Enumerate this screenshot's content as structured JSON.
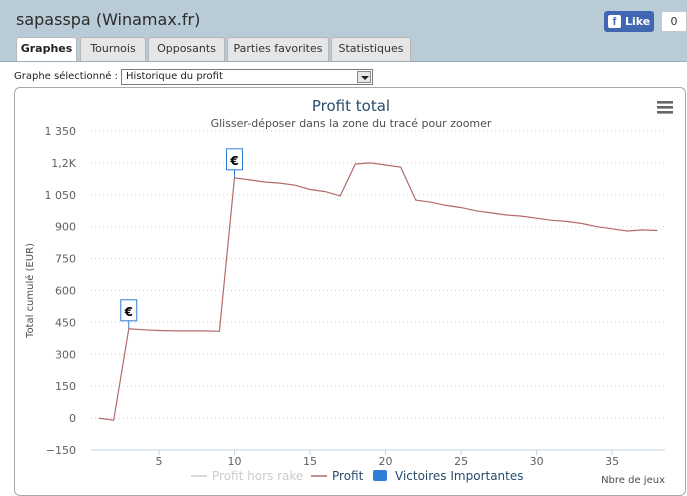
{
  "header": {
    "title": "sapasspa (Winamax.fr)",
    "like": {
      "label": "Like",
      "count": "0",
      "icon": "facebook-icon"
    }
  },
  "tabs": [
    {
      "label": "Graphes",
      "active": true
    },
    {
      "label": "Tournois",
      "active": false
    },
    {
      "label": "Opposants",
      "active": false
    },
    {
      "label": "Parties favorites",
      "active": false
    },
    {
      "label": "Statistiques",
      "active": false
    }
  ],
  "graph_select": {
    "label": "Graphe sélectionné :",
    "value": "Historique du profit"
  },
  "chart_menu_icon": "hamburger-menu-icon",
  "chart_data": {
    "type": "line",
    "title": "Profit total",
    "subtitle": "Glisser-déposer dans la zone du tracé pour zoomer",
    "xlabel": "Nbre de jeux",
    "ylabel": "Total cumulé (EUR)",
    "xlim": [
      0.5,
      38.5
    ],
    "ylim": [
      -150,
      1350
    ],
    "xticks": [
      5,
      10,
      15,
      20,
      25,
      30,
      35
    ],
    "yticks": [
      {
        "value": 1350,
        "label": "1 350"
      },
      {
        "value": 1200,
        "label": "1,2K"
      },
      {
        "value": 1050,
        "label": "1 050"
      },
      {
        "value": 900,
        "label": "900"
      },
      {
        "value": 750,
        "label": "750"
      },
      {
        "value": 600,
        "label": "600"
      },
      {
        "value": 450,
        "label": "450"
      },
      {
        "value": 300,
        "label": "300"
      },
      {
        "value": 150,
        "label": "150"
      },
      {
        "value": 0,
        "label": "0"
      },
      {
        "value": -150,
        "label": "−150"
      }
    ],
    "grid": true,
    "legend_position": "bottom",
    "series": [
      {
        "name": "Profit hors rake",
        "color": "#cccccc",
        "hidden": true,
        "values": []
      },
      {
        "name": "Profit",
        "color": "#b46a6a",
        "x": [
          1,
          2,
          3,
          4,
          5,
          6,
          7,
          8,
          9,
          10,
          11,
          12,
          13,
          14,
          15,
          16,
          17,
          18,
          19,
          20,
          21,
          22,
          23,
          24,
          25,
          26,
          27,
          28,
          29,
          30,
          31,
          32,
          33,
          34,
          35,
          36,
          37,
          38
        ],
        "values": [
          0,
          -10,
          420,
          415,
          412,
          410,
          410,
          410,
          408,
          1130,
          1120,
          1110,
          1105,
          1095,
          1075,
          1065,
          1045,
          1195,
          1200,
          1190,
          1180,
          1025,
          1015,
          1000,
          990,
          975,
          965,
          955,
          950,
          940,
          930,
          925,
          915,
          900,
          890,
          880,
          885,
          882
        ]
      },
      {
        "name": "Victoires Importantes",
        "color": "#2f7ed8",
        "type": "flags",
        "points": [
          {
            "x": 3,
            "y": 420,
            "label": "€"
          },
          {
            "x": 10,
            "y": 1130,
            "label": "€"
          }
        ]
      }
    ]
  }
}
